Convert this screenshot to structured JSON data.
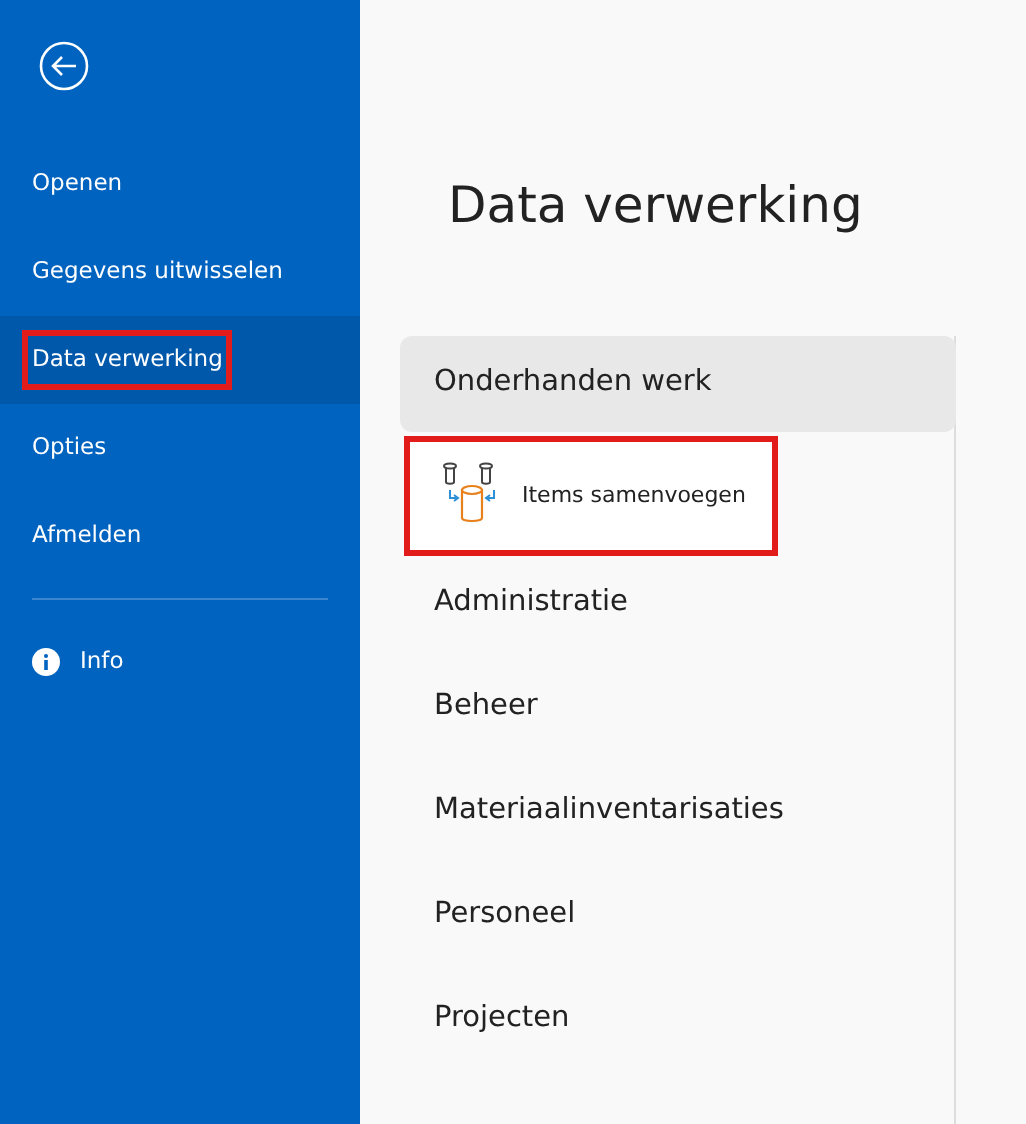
{
  "sidebar": {
    "items": [
      {
        "label": "Openen",
        "selected": false,
        "highlighted": false,
        "kind": "text"
      },
      {
        "label": "Gegevens uitwisselen",
        "selected": false,
        "highlighted": false,
        "kind": "text"
      },
      {
        "label": "Data verwerking",
        "selected": true,
        "highlighted": true,
        "kind": "text"
      },
      {
        "label": "Opties",
        "selected": false,
        "highlighted": false,
        "kind": "text"
      },
      {
        "label": "Afmelden",
        "selected": false,
        "highlighted": false,
        "kind": "text"
      },
      {
        "kind": "divider"
      },
      {
        "label": "Info",
        "selected": false,
        "highlighted": false,
        "kind": "info"
      }
    ]
  },
  "page": {
    "title": "Data verwerking",
    "categories": [
      {
        "label": "Onderhanden werk",
        "selected": true,
        "items": [
          {
            "label": "Items samenvoegen",
            "highlighted": true
          }
        ]
      },
      {
        "label": "Administratie",
        "selected": false
      },
      {
        "label": "Beheer",
        "selected": false
      },
      {
        "label": "Materiaalinventarisaties",
        "selected": false
      },
      {
        "label": "Personeel",
        "selected": false
      },
      {
        "label": "Projecten",
        "selected": false
      }
    ]
  }
}
